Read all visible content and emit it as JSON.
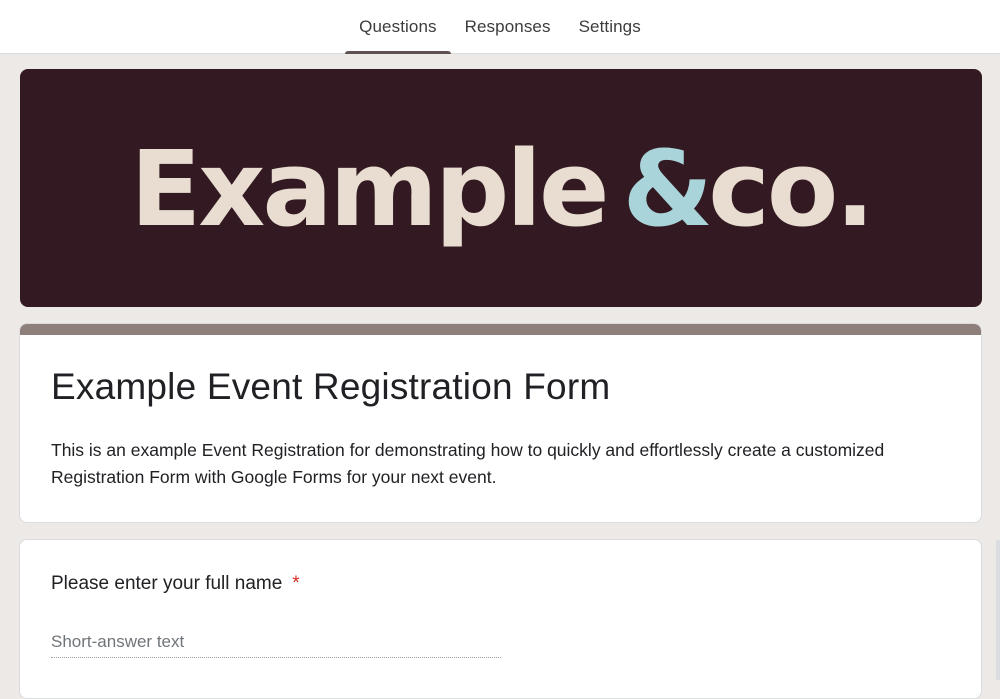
{
  "tabs": [
    {
      "label": "Questions",
      "active": true
    },
    {
      "label": "Responses",
      "active": false
    },
    {
      "label": "Settings",
      "active": false
    }
  ],
  "banner": {
    "logo_word": "Example",
    "logo_amp": "&",
    "logo_co": "co.",
    "background_color": "#331a22",
    "word_color": "#e8ddd0",
    "amp_color": "#a8d4da"
  },
  "form": {
    "title": "Example Event Registration Form",
    "description": "This is an example Event Registration for demonstrating how to quickly and effortlessly create a customized Registration Form with Google Forms for your next event.",
    "accent_color": "#8f7f7a"
  },
  "questions": [
    {
      "title": "Please enter your full name",
      "required_marker": "*",
      "placeholder": "Short-answer text"
    }
  ]
}
